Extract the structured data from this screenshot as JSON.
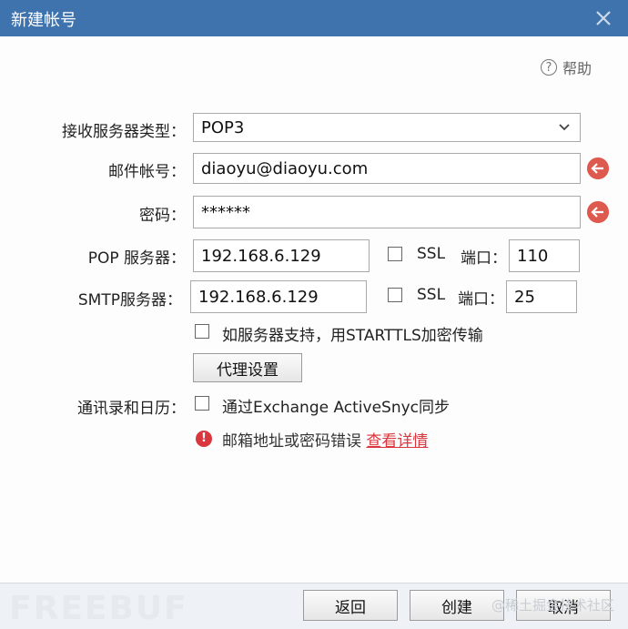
{
  "window": {
    "title": "新建帐号",
    "close_icon": "close-icon"
  },
  "help": {
    "label": "帮助",
    "icon": "?"
  },
  "form": {
    "server_type": {
      "label": "接收服务器类型：",
      "value": "POP3"
    },
    "email": {
      "label": "邮件帐号：",
      "value": "diaoyu@diaoyu.com"
    },
    "password": {
      "label": "密码：",
      "value": "******"
    },
    "pop": {
      "label": "POP 服务器：",
      "server": "192.168.6.129",
      "ssl_label": "SSL",
      "port_label": "端口：",
      "port": "110",
      "ssl_checked": false
    },
    "smtp": {
      "label": "SMTP服务器：",
      "server": "192.168.6.129",
      "ssl_label": "SSL",
      "port_label": "端口：",
      "port": "25",
      "ssl_checked": false
    },
    "starttls": {
      "label": "如服务器支持，用STARTTLS加密传输",
      "checked": false
    },
    "proxy_button": "代理设置",
    "contacts": {
      "label": "通讯录和日历：",
      "option": "通过Exchange ActiveSnyc同步",
      "checked": false
    }
  },
  "error": {
    "icon": "!",
    "message": "邮箱地址或密码错误",
    "link": "查看详情"
  },
  "footer": {
    "back": "返回",
    "create": "创建",
    "cancel": "取消"
  },
  "watermark": {
    "logo": "FREEBUF",
    "text": "@稀土掘金技术社区"
  },
  "colors": {
    "titlebar": "#3f73ad",
    "warning": "#df5a4e",
    "error": "#d9363e"
  }
}
